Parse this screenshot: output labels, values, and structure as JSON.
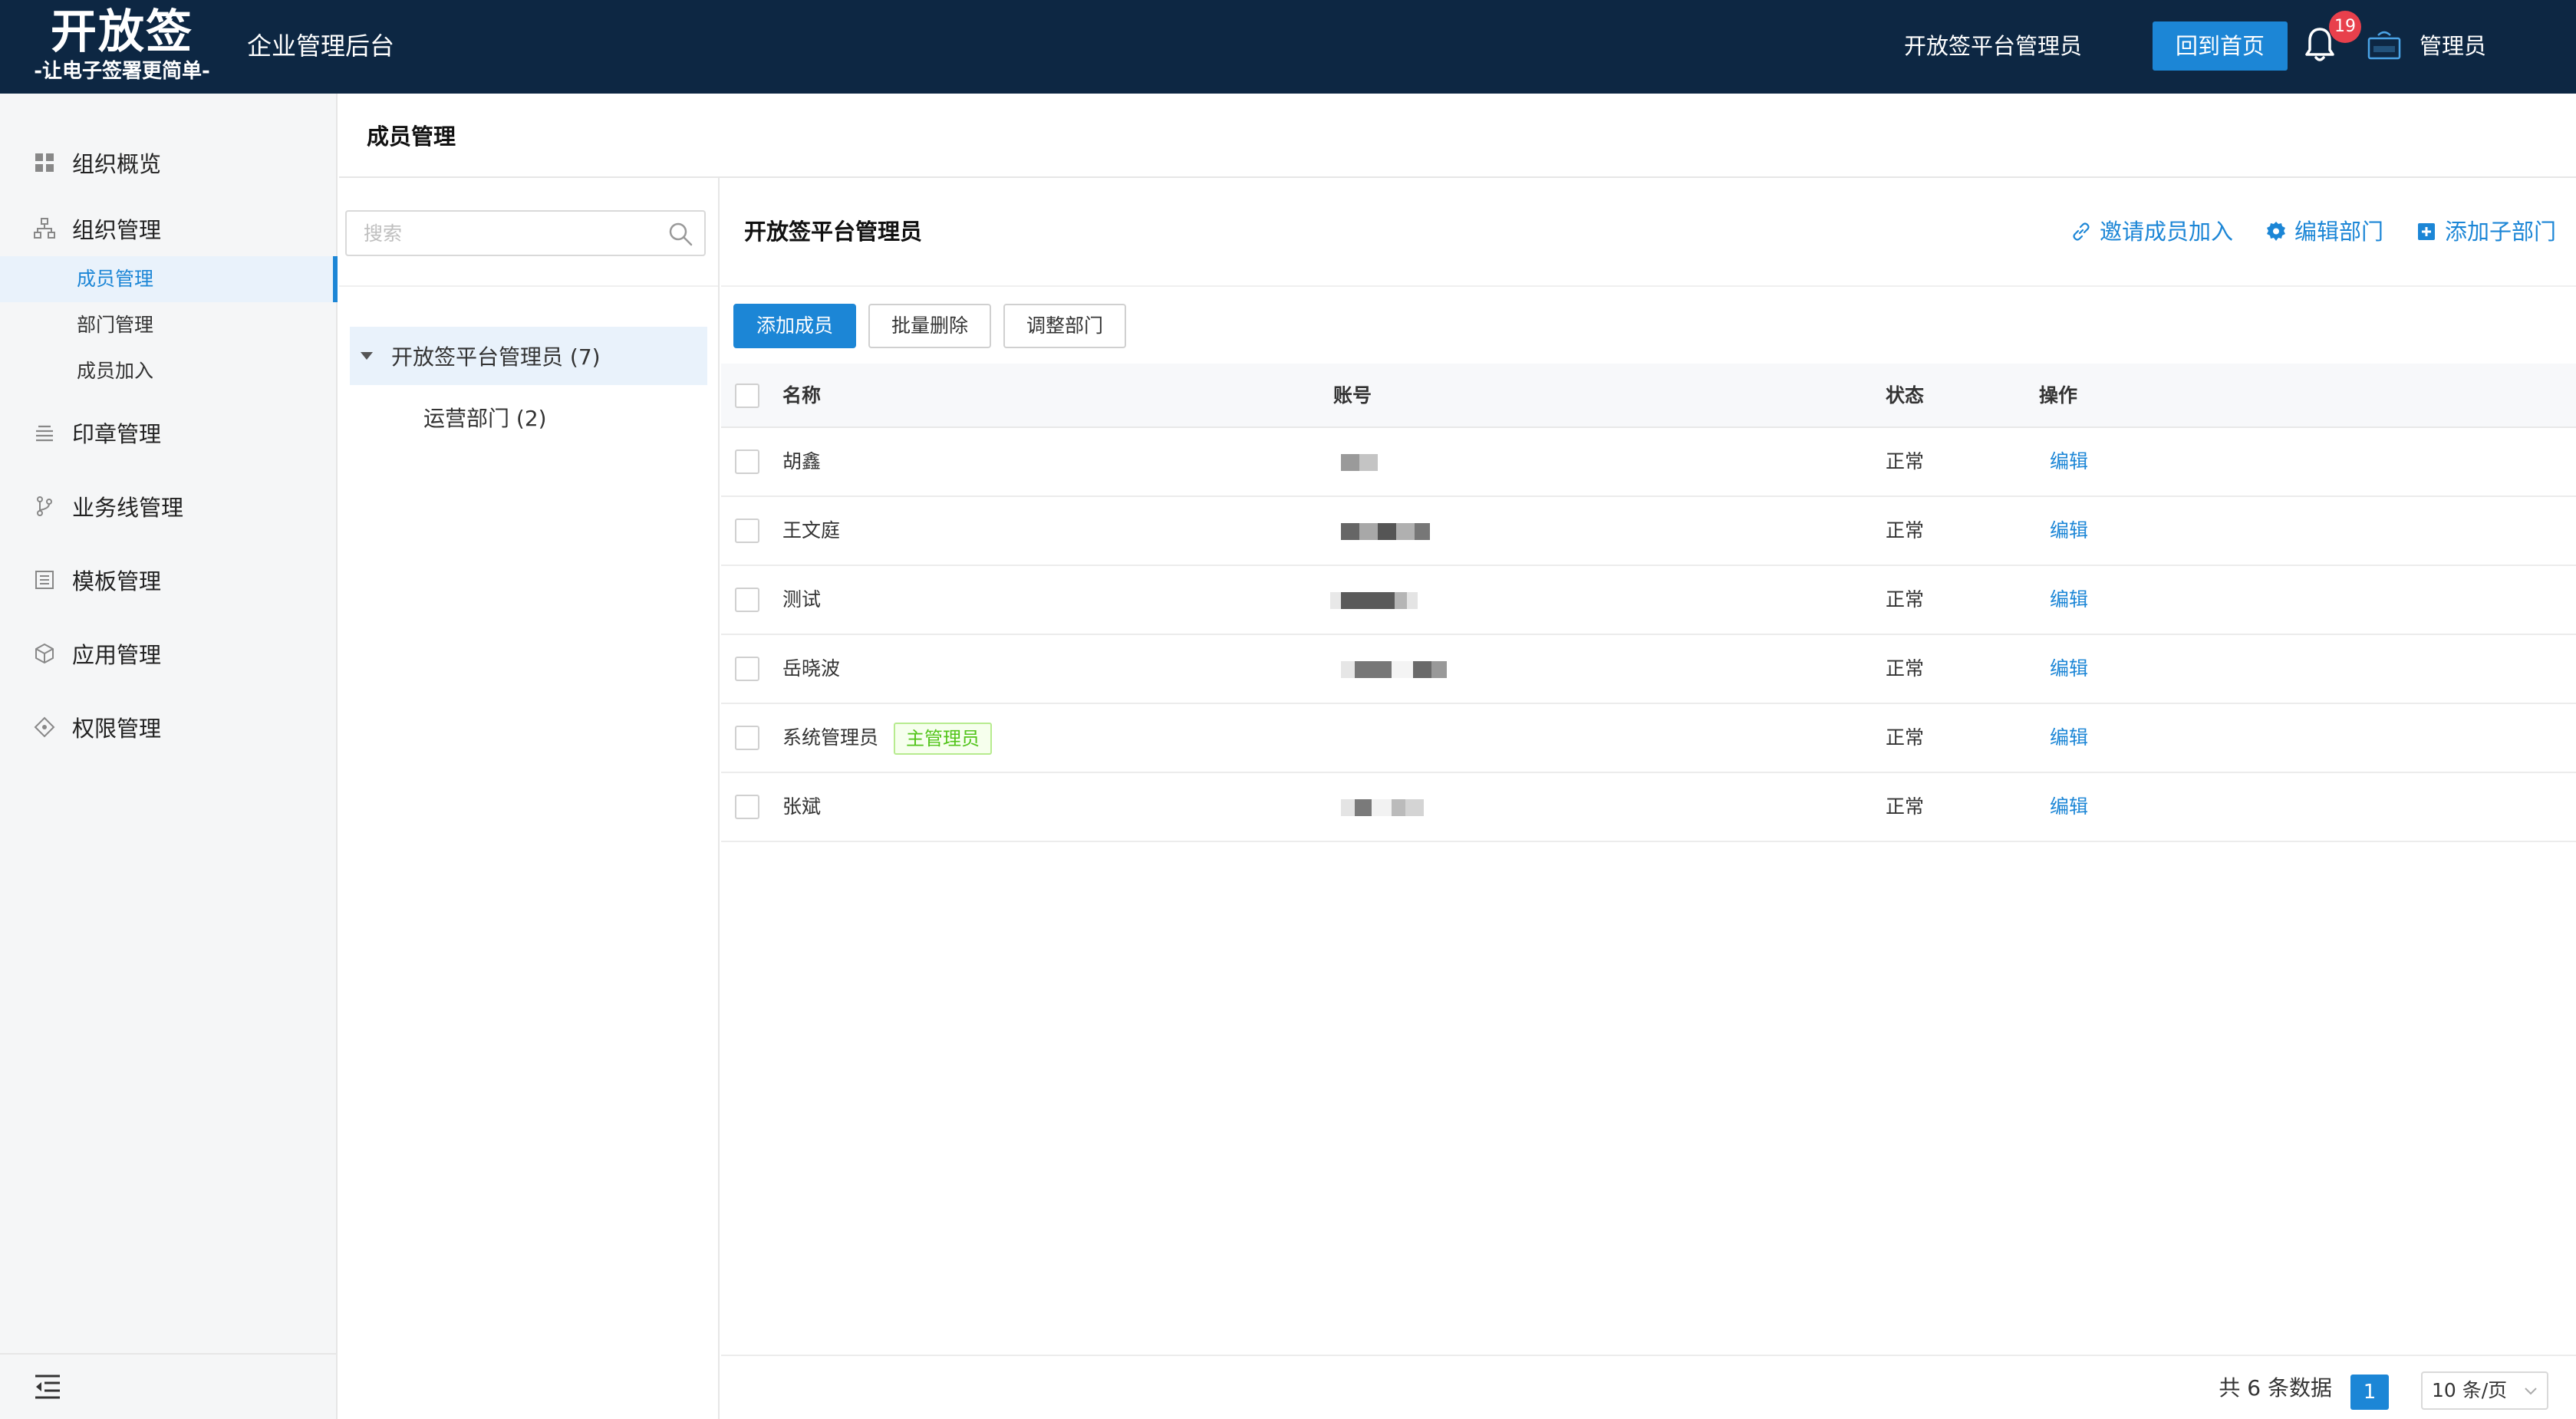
{
  "header": {
    "logo_main": "开放签",
    "logo_sub": "-让电子签署更简单-",
    "app_title": "企业管理后台",
    "tenant_name": "开放签平台管理员",
    "home_button": "回到首页",
    "notification_count": "19",
    "user_name": "管理员"
  },
  "sidebar": {
    "items": [
      {
        "label": "组织概览",
        "icon": "grid-icon"
      },
      {
        "label": "组织管理",
        "icon": "org-tree-icon"
      },
      {
        "label": "印章管理",
        "icon": "list-lines-icon"
      },
      {
        "label": "业务线管理",
        "icon": "branch-icon"
      },
      {
        "label": "模板管理",
        "icon": "template-icon"
      },
      {
        "label": "应用管理",
        "icon": "cube-icon"
      },
      {
        "label": "权限管理",
        "icon": "permission-icon"
      }
    ],
    "sub_items": [
      {
        "label": "成员管理",
        "active": true
      },
      {
        "label": "部门管理",
        "active": false
      },
      {
        "label": "成员加入",
        "active": false
      }
    ]
  },
  "page": {
    "title": "成员管理"
  },
  "tree": {
    "search_placeholder": "搜索",
    "nodes": [
      {
        "label": "开放签平台管理员 (7)",
        "selected": true,
        "expanded": true
      },
      {
        "label": "运营部门 (2)",
        "selected": false
      }
    ]
  },
  "content": {
    "dept_title": "开放签平台管理员",
    "actions": {
      "invite": "邀请成员加入",
      "edit_dept": "编辑部门",
      "add_sub_dept": "添加子部门"
    },
    "buttons": {
      "add_member": "添加成员",
      "batch_delete": "批量删除",
      "adjust_dept": "调整部门"
    }
  },
  "table": {
    "headers": {
      "name": "名称",
      "account": "账号",
      "status": "状态",
      "action": "操作"
    },
    "rows": [
      {
        "name": "胡鑫",
        "status": "正常",
        "action": "编辑",
        "tag": ""
      },
      {
        "name": "王文庭",
        "status": "正常",
        "action": "编辑",
        "tag": ""
      },
      {
        "name": "测试",
        "status": "正常",
        "action": "编辑",
        "tag": ""
      },
      {
        "name": "岳晓波",
        "status": "正常",
        "action": "编辑",
        "tag": ""
      },
      {
        "name": "系统管理员",
        "status": "正常",
        "action": "编辑",
        "tag": "主管理员"
      },
      {
        "name": "张斌",
        "status": "正常",
        "action": "编辑",
        "tag": ""
      }
    ]
  },
  "pagination": {
    "total_text": "共 6 条数据",
    "current_page": "1",
    "page_size": "10 条/页"
  },
  "colors": {
    "header_bg": "#0d2743",
    "accent": "#1c86d6",
    "badge": "#e8404c",
    "tag_green": "#52c41a"
  }
}
